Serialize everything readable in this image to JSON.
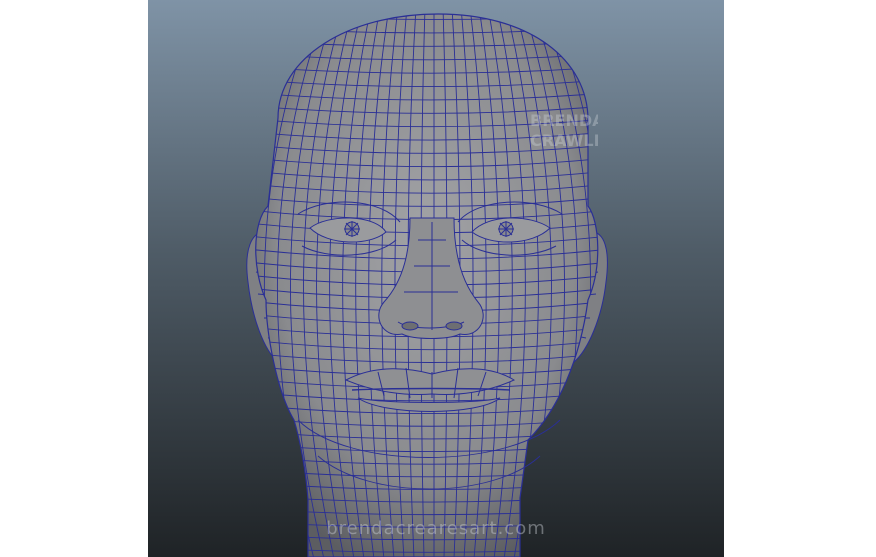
{
  "viewport": {
    "background_top": "#7f93a6",
    "background_bottom": "#1f2326",
    "mesh_fill": "#8d8e91",
    "wire_color": "#2a2f96",
    "model": "head-wireframe"
  },
  "watermark": {
    "url_text": "brendacrearesart.com",
    "logo_text": "BRENDA CRAWLEY"
  }
}
